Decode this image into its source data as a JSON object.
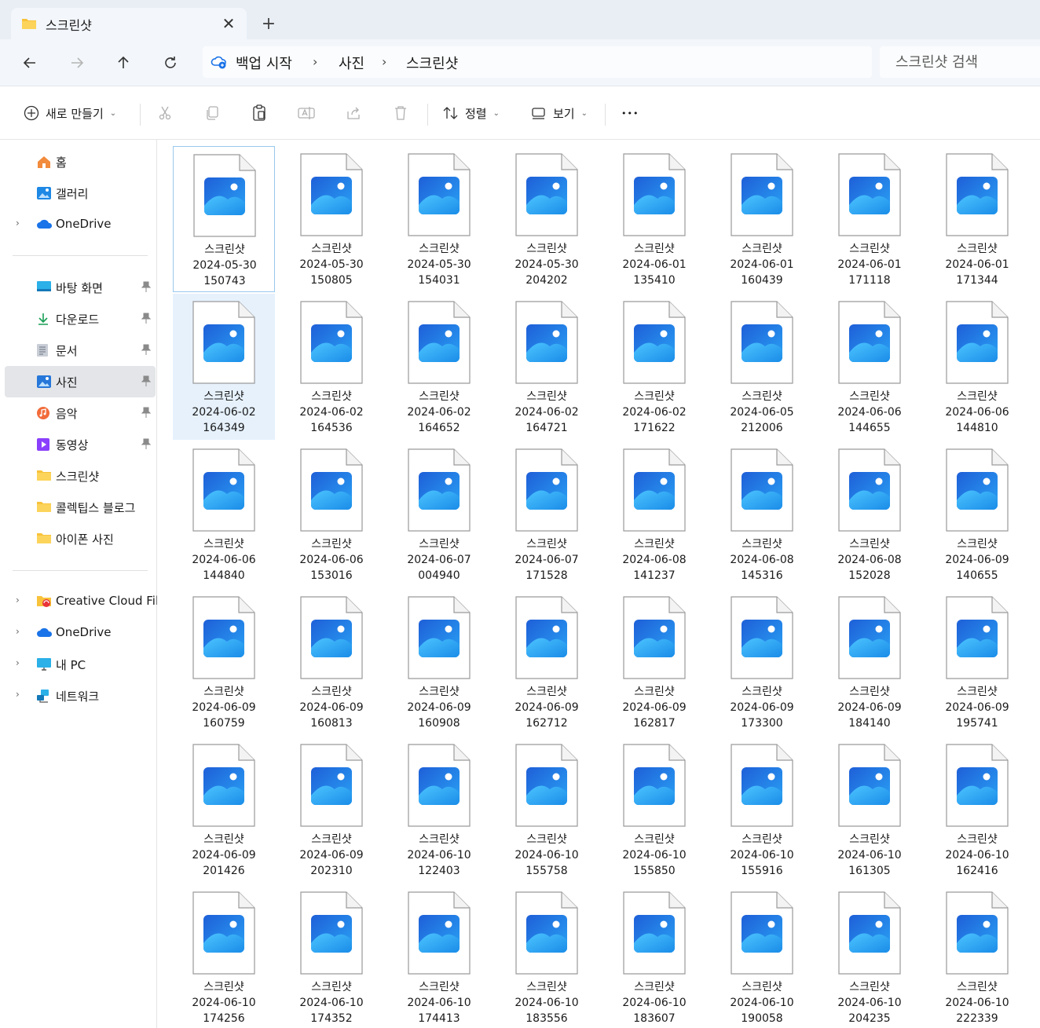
{
  "tab": {
    "title": "스크린샷",
    "close_glyph": "✕",
    "new_tab_glyph": "+"
  },
  "address": {
    "breadcrumbs": [
      "백업 시작",
      "사진",
      "스크린샷"
    ],
    "separator": "›"
  },
  "search": {
    "placeholder": "스크린샷 검색"
  },
  "toolbar": {
    "new_label": "새로 만들기",
    "sort_label": "정렬",
    "view_label": "보기",
    "more_glyph": "•••"
  },
  "sidebar": {
    "top": [
      {
        "label": "홈",
        "icon": "home-icon"
      },
      {
        "label": "갤러리",
        "icon": "gallery-icon"
      },
      {
        "label": "OneDrive",
        "icon": "onedrive-icon"
      }
    ],
    "quick": [
      {
        "label": "바탕 화면",
        "icon": "desktop-icon",
        "pinned": true
      },
      {
        "label": "다운로드",
        "icon": "download-icon",
        "pinned": true
      },
      {
        "label": "문서",
        "icon": "documents-icon",
        "pinned": true
      },
      {
        "label": "사진",
        "icon": "pictures-icon",
        "pinned": true,
        "selected": true
      },
      {
        "label": "음악",
        "icon": "music-icon",
        "pinned": true
      },
      {
        "label": "동영상",
        "icon": "videos-icon",
        "pinned": true
      },
      {
        "label": "스크린샷",
        "icon": "folder-icon",
        "pinned": false
      },
      {
        "label": "콜렉팁스 블로그",
        "icon": "folder-icon",
        "pinned": false
      },
      {
        "label": "아이폰 사진",
        "icon": "folder-icon",
        "pinned": false
      }
    ],
    "locations": [
      {
        "label": "Creative Cloud Files",
        "icon": "creative-cloud-icon"
      },
      {
        "label": "OneDrive",
        "icon": "onedrive-icon"
      },
      {
        "label": "내 PC",
        "icon": "pc-icon"
      },
      {
        "label": "네트워크",
        "icon": "network-icon"
      }
    ],
    "pin_glyph": "📌",
    "expander_glyph": "›"
  },
  "files": [
    {
      "name": "스크린샷\n2024-05-30\n150743"
    },
    {
      "name": "스크린샷\n2024-05-30\n150805"
    },
    {
      "name": "스크린샷\n2024-05-30\n154031"
    },
    {
      "name": "스크린샷\n2024-05-30\n204202"
    },
    {
      "name": "스크린샷\n2024-06-01\n135410"
    },
    {
      "name": "스크린샷\n2024-06-01\n160439"
    },
    {
      "name": "스크린샷\n2024-06-01\n171118"
    },
    {
      "name": "스크린샷\n2024-06-01\n171344"
    },
    {
      "name": "스크린샷\n2024-06-02\n164349"
    },
    {
      "name": "스크린샷\n2024-06-02\n164536"
    },
    {
      "name": "스크린샷\n2024-06-02\n164652"
    },
    {
      "name": "스크린샷\n2024-06-02\n164721"
    },
    {
      "name": "스크린샷\n2024-06-02\n171622"
    },
    {
      "name": "스크린샷\n2024-06-05\n212006"
    },
    {
      "name": "스크린샷\n2024-06-06\n144655"
    },
    {
      "name": "스크린샷\n2024-06-06\n144810"
    },
    {
      "name": "스크린샷\n2024-06-06\n144840"
    },
    {
      "name": "스크린샷\n2024-06-06\n153016"
    },
    {
      "name": "스크린샷\n2024-06-07\n004940"
    },
    {
      "name": "스크린샷\n2024-06-07\n171528"
    },
    {
      "name": "스크린샷\n2024-06-08\n141237"
    },
    {
      "name": "스크린샷\n2024-06-08\n145316"
    },
    {
      "name": "스크린샷\n2024-06-08\n152028"
    },
    {
      "name": "스크린샷\n2024-06-09\n140655"
    },
    {
      "name": "스크린샷\n2024-06-09\n160759"
    },
    {
      "name": "스크린샷\n2024-06-09\n160813"
    },
    {
      "name": "스크린샷\n2024-06-09\n160908"
    },
    {
      "name": "스크린샷\n2024-06-09\n162712"
    },
    {
      "name": "스크린샷\n2024-06-09\n162817"
    },
    {
      "name": "스크린샷\n2024-06-09\n173300"
    },
    {
      "name": "스크린샷\n2024-06-09\n184140"
    },
    {
      "name": "스크린샷\n2024-06-09\n195741"
    },
    {
      "name": "스크린샷\n2024-06-09\n201426"
    },
    {
      "name": "스크린샷\n2024-06-09\n202310"
    },
    {
      "name": "스크린샷\n2024-06-10\n122403"
    },
    {
      "name": "스크린샷\n2024-06-10\n155758"
    },
    {
      "name": "스크린샷\n2024-06-10\n155850"
    },
    {
      "name": "스크린샷\n2024-06-10\n155916"
    },
    {
      "name": "스크린샷\n2024-06-10\n161305"
    },
    {
      "name": "스크린샷\n2024-06-10\n162416"
    },
    {
      "name": "스크린샷\n2024-06-10\n174256"
    },
    {
      "name": "스크린샷\n2024-06-10\n174352"
    },
    {
      "name": "스크린샷\n2024-06-10\n174413"
    },
    {
      "name": "스크린샷\n2024-06-10\n183556"
    },
    {
      "name": "스크린샷\n2024-06-10\n183607"
    },
    {
      "name": "스크린샷\n2024-06-10\n190058"
    },
    {
      "name": "스크린샷\n2024-06-10\n204235"
    },
    {
      "name": "스크린샷\n2024-06-10\n222339"
    }
  ],
  "focused_file_index": 0,
  "hovered_file_index": 8,
  "colors": {
    "accent": "#0067c0",
    "folder": "#f8c23a",
    "image_icon": "#1e90ff"
  }
}
